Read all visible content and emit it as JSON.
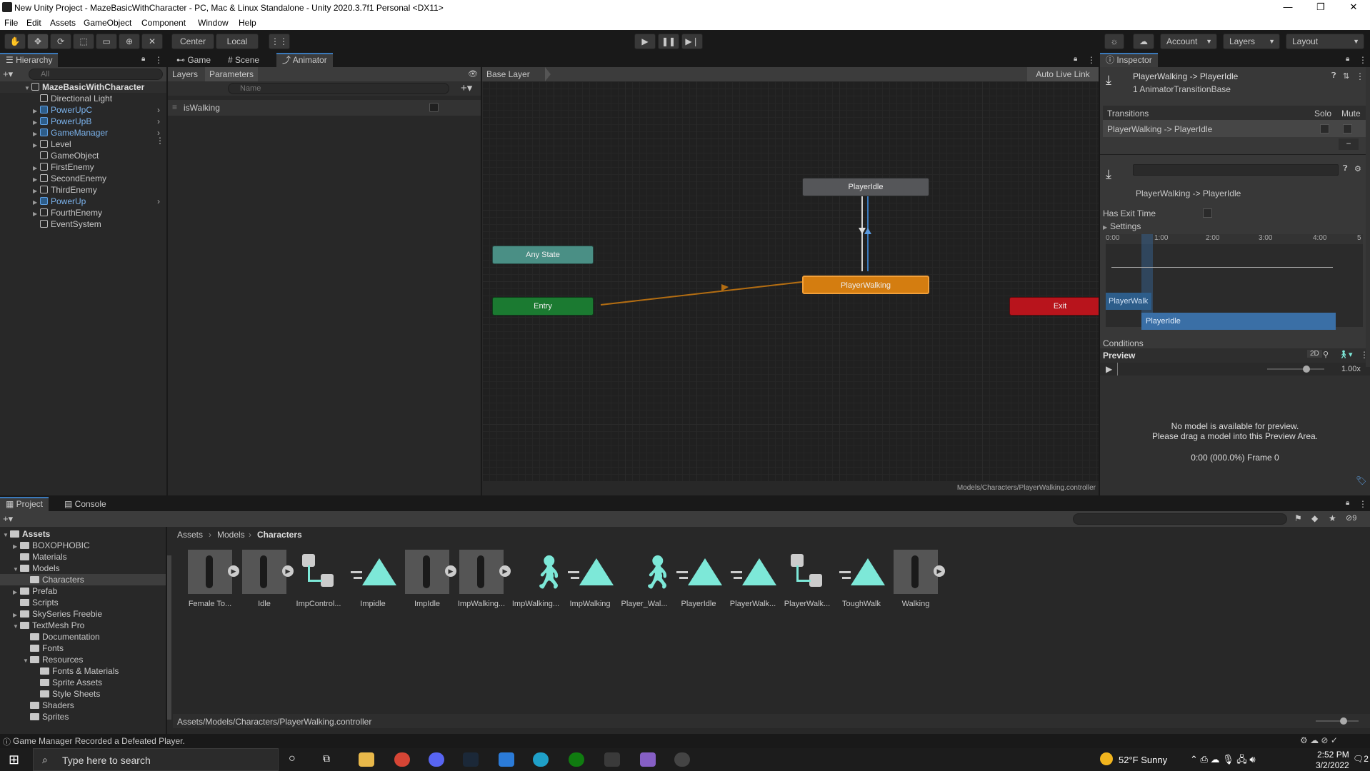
{
  "window": {
    "title": "New Unity Project - MazeBasicWithCharacter - PC, Mac & Linux Standalone - Unity 2020.3.7f1 Personal <DX11>",
    "min": "—",
    "max": "❐",
    "close": "✕"
  },
  "menu": [
    "File",
    "Edit",
    "Assets",
    "GameObject",
    "Component",
    "Window",
    "Help"
  ],
  "toolbar": {
    "center": "Center",
    "local": "Local",
    "account": "Account",
    "layers": "Layers",
    "layout": "Layout"
  },
  "hierarchy": {
    "tab": "Hierarchy",
    "search_placeholder": "All",
    "root": "MazeBasicWithCharacter",
    "items": [
      {
        "label": "Directional Light",
        "blue": false,
        "exp": false
      },
      {
        "label": "PowerUpC",
        "blue": true,
        "exp": true
      },
      {
        "label": "PowerUpB",
        "blue": true,
        "exp": true
      },
      {
        "label": "GameManager",
        "blue": true,
        "exp": true
      },
      {
        "label": "Level",
        "blue": false,
        "exp": true
      },
      {
        "label": "GameObject",
        "blue": false,
        "exp": false
      },
      {
        "label": "FirstEnemy",
        "blue": false,
        "exp": true
      },
      {
        "label": "SecondEnemy",
        "blue": false,
        "exp": true
      },
      {
        "label": "ThirdEnemy",
        "blue": false,
        "exp": true
      },
      {
        "label": "PowerUp",
        "blue": true,
        "exp": true
      },
      {
        "label": "FourthEnemy",
        "blue": false,
        "exp": true
      },
      {
        "label": "EventSystem",
        "blue": false,
        "exp": false
      }
    ]
  },
  "animator": {
    "tabs": {
      "game": "Game",
      "scene": "Scene",
      "animator": "Animator"
    },
    "layers_tab": "Layers",
    "params_tab": "Parameters",
    "search_placeholder": "Name",
    "param": "isWalking",
    "base_layer": "Base Layer",
    "auto_live": "Auto Live Link",
    "path": "Models/Characters/PlayerWalking.controller",
    "nodes": {
      "idle": "PlayerIdle",
      "any": "Any State",
      "walking": "PlayerWalking",
      "entry": "Entry",
      "exit": "Exit"
    }
  },
  "inspector": {
    "tab": "Inspector",
    "title": "PlayerWalking -> PlayerIdle",
    "subtitle": "1 AnimatorTransitionBase",
    "transitions": "Transitions",
    "solo": "Solo",
    "mute": "Mute",
    "transition_row": "PlayerWalking -> PlayerIdle",
    "minus": "−",
    "transition_name": "PlayerWalking -> PlayerIdle",
    "has_exit": "Has Exit Time",
    "settings": "Settings",
    "ticks": [
      "0:00",
      "1:00",
      "2:00",
      "3:00",
      "4:00",
      "5"
    ],
    "clip_a": "PlayerWalk",
    "clip_b": "PlayerIdle",
    "conditions": "Conditions",
    "preview": "Preview",
    "twod": "2D",
    "speed": "1.00x",
    "nomodel1": "No model is available for preview.",
    "nomodel2": "Please drag a model into this Preview Area.",
    "frame": "0:00 (000.0%) Frame 0"
  },
  "project": {
    "tab_project": "Project",
    "tab_console": "Console",
    "badge": "9",
    "breadcrumb": [
      "Assets",
      "Models",
      "Characters"
    ],
    "tree": [
      {
        "label": "Assets",
        "lvl": 0,
        "bold": true,
        "exp": "▼"
      },
      {
        "label": "BOXOPHOBIC",
        "lvl": 1,
        "exp": "▶"
      },
      {
        "label": "Materials",
        "lvl": 1,
        "exp": ""
      },
      {
        "label": "Models",
        "lvl": 1,
        "exp": "▼"
      },
      {
        "label": "Characters",
        "lvl": 2,
        "exp": "",
        "sel": true
      },
      {
        "label": "Prefab",
        "lvl": 1,
        "exp": "▶"
      },
      {
        "label": "Scripts",
        "lvl": 1,
        "exp": ""
      },
      {
        "label": "SkySeries Freebie",
        "lvl": 1,
        "exp": "▶"
      },
      {
        "label": "TextMesh Pro",
        "lvl": 1,
        "exp": "▼"
      },
      {
        "label": "Documentation",
        "lvl": 2,
        "exp": ""
      },
      {
        "label": "Fonts",
        "lvl": 2,
        "exp": ""
      },
      {
        "label": "Resources",
        "lvl": 2,
        "exp": "▼"
      },
      {
        "label": "Fonts & Materials",
        "lvl": 3,
        "exp": ""
      },
      {
        "label": "Sprite Assets",
        "lvl": 3,
        "exp": ""
      },
      {
        "label": "Style Sheets",
        "lvl": 3,
        "exp": ""
      },
      {
        "label": "Shaders",
        "lvl": 2,
        "exp": ""
      },
      {
        "label": "Sprites",
        "lvl": 2,
        "exp": ""
      }
    ],
    "assets": [
      {
        "label": "Female To...",
        "kind": "model"
      },
      {
        "label": "Idle",
        "kind": "model"
      },
      {
        "label": "ImpControl...",
        "kind": "controller"
      },
      {
        "label": "Impidle",
        "kind": "clip"
      },
      {
        "label": "ImpIdle",
        "kind": "model"
      },
      {
        "label": "ImpWalking...",
        "kind": "model"
      },
      {
        "label": "ImpWalking...",
        "kind": "avatar"
      },
      {
        "label": "ImpWalking",
        "kind": "clip"
      },
      {
        "label": "Player_Wal...",
        "kind": "avatar"
      },
      {
        "label": "PlayerIdle",
        "kind": "clip"
      },
      {
        "label": "PlayerWalk...",
        "kind": "clip"
      },
      {
        "label": "PlayerWalk...",
        "kind": "controller"
      },
      {
        "label": "ToughWalk",
        "kind": "clip"
      },
      {
        "label": "Walking",
        "kind": "model"
      }
    ],
    "footer_path": "Assets/Models/Characters/PlayerWalking.controller"
  },
  "status": "Game Manager Recorded a Defeated Player.",
  "taskbar": {
    "search": "Type here to search",
    "weather": "52°F  Sunny",
    "time": "2:52 PM",
    "date": "3/2/2022",
    "notif": "2"
  },
  "colors": {
    "accent": "#3a79bb",
    "idle": "#555659",
    "any": "#4a8f85",
    "walking": "#d47d10",
    "entry": "#1b7a31",
    "exit": "#b8141c",
    "clip": "#7de8d8"
  }
}
